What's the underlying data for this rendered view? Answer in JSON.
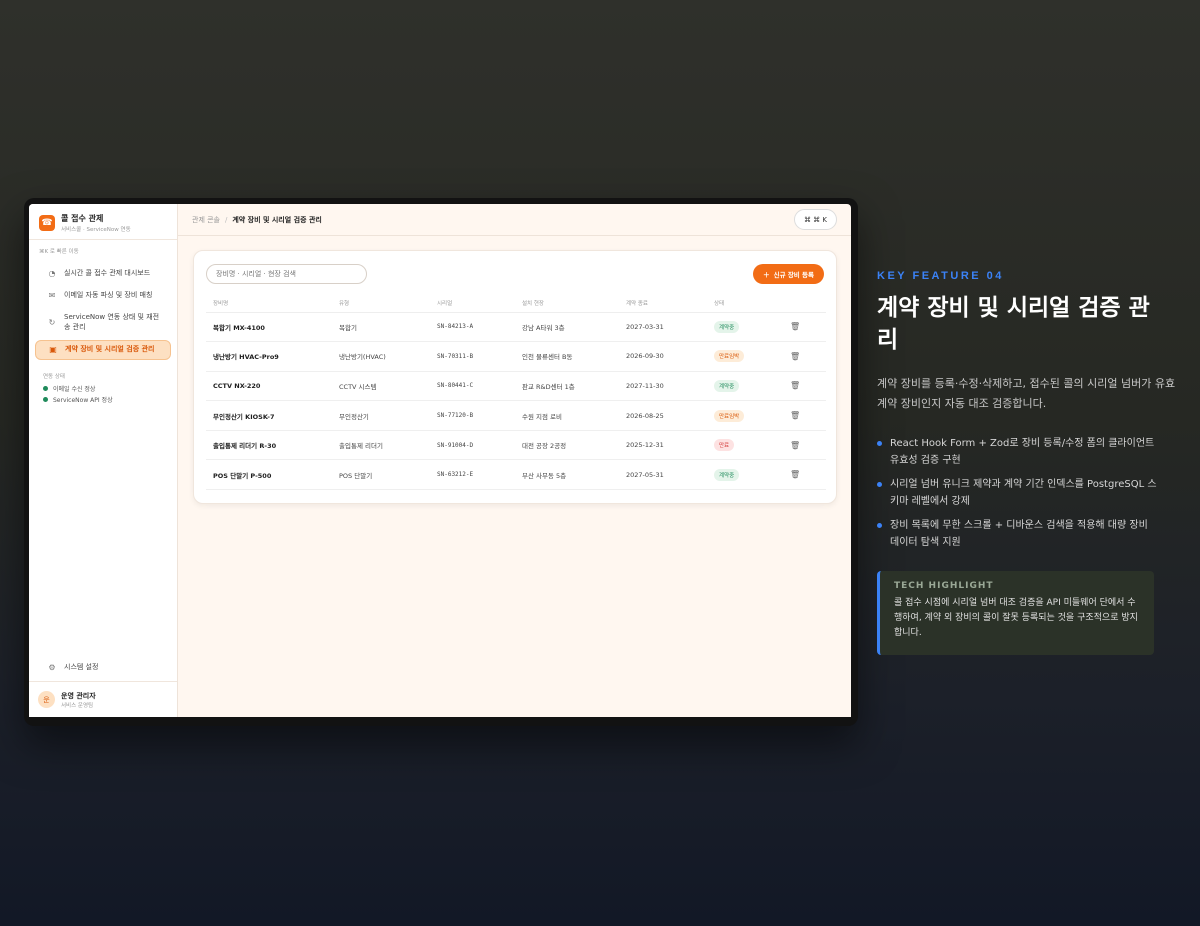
{
  "sidebar": {
    "brand_title": "콜 접수 관제",
    "brand_subtitle": "서비스콜 · ServiceNow 연동",
    "quick_hint": "⌘K 로 빠른 이동",
    "items": [
      {
        "label": "실시간 콜 접수 관제 대시보드",
        "icon": "gauge-icon"
      },
      {
        "label": "이메일 자동 파싱 및 장비 매칭",
        "icon": "mail-icon"
      },
      {
        "label": "ServiceNow 연동 상태 및 재전송 관리",
        "icon": "refresh-icon"
      },
      {
        "label": "계약 장비 및 시리얼 검증 관리",
        "icon": "device-icon",
        "active": true
      }
    ],
    "status_heading": "연동 상태",
    "status": [
      {
        "label": "이메일 수신 정상",
        "color": "#1f8a5b"
      },
      {
        "label": "ServiceNow API 정상",
        "color": "#1f8a5b"
      }
    ],
    "settings_label": "시스템 설정",
    "profile": {
      "avatar": "운",
      "name": "운영 관리자",
      "role": "서비스 운영팀"
    }
  },
  "topbar": {
    "crumb_parent": "관제 콘솔",
    "crumb_current": "계약 장비 및 시리얼 검증 관리",
    "shortcut": "⌘ ⌘ K"
  },
  "card": {
    "search_placeholder": "장비명 · 시리얼 · 현장 검색",
    "add_button": "신규 장비 등록",
    "columns": [
      "장비명",
      "유형",
      "시리얼",
      "설치 현장",
      "계약 종료",
      "상태",
      ""
    ],
    "rows": [
      {
        "name": "복합기 MX-4100",
        "type": "복합기",
        "serial": "SN-84213-A",
        "site": "강남 A타워 3층",
        "end": "2027-03-31",
        "status": "계약중",
        "kind": "ok"
      },
      {
        "name": "냉난방기 HVAC-Pro9",
        "type": "냉난방기(HVAC)",
        "serial": "SN-70311-B",
        "site": "인천 물류센터 B동",
        "end": "2026-09-30",
        "status": "만료임박",
        "kind": "warn"
      },
      {
        "name": "CCTV NX-220",
        "type": "CCTV 시스템",
        "serial": "SN-80441-C",
        "site": "판교 R&D센터 1층",
        "end": "2027-11-30",
        "status": "계약중",
        "kind": "ok"
      },
      {
        "name": "무인정산기 KIOSK-7",
        "type": "무인정산기",
        "serial": "SN-77120-B",
        "site": "수원 지점 로비",
        "end": "2026-08-25",
        "status": "만료임박",
        "kind": "warn"
      },
      {
        "name": "출입통제 리더기 R-30",
        "type": "출입통제 리더기",
        "serial": "SN-91004-D",
        "site": "대전 공장 2공정",
        "end": "2025-12-31",
        "status": "만료",
        "kind": "end"
      },
      {
        "name": "POS 단말기 P-500",
        "type": "POS 단말기",
        "serial": "SN-63212-E",
        "site": "부산 사무동 5층",
        "end": "2027-05-31",
        "status": "계약중",
        "kind": "ok"
      }
    ]
  },
  "feature": {
    "tag": "KEY FEATURE 04",
    "title": "계약 장비 및 시리얼 검증 관리",
    "description": "계약 장비를 등록·수정·삭제하고, 접수된 콜의 시리얼 넘버가 유효 계약 장비인지 자동 대조 검증합니다.",
    "bullets": [
      "React Hook Form + Zod로 장비 등록/수정 폼의 클라이언트 유효성 검증 구현",
      "시리얼 넘버 유니크 제약과 계약 기간 인덱스를 PostgreSQL 스키마 레벨에서 강제",
      "장비 목록에 무한 스크롤 + 디바운스 검색을 적용해 대량 장비 데이터 탐색 지원"
    ],
    "highlight_title": "TECH HIGHLIGHT",
    "highlight_text": "콜 접수 시점에 시리얼 넘버 대조 검증을 API 미들웨어 단에서 수행하여, 계약 외 장비의 콜이 잘못 등록되는 것을 구조적으로 방지합니다."
  },
  "colors": {
    "accent": "#f26c15",
    "feature_blue": "#3b82f6"
  }
}
